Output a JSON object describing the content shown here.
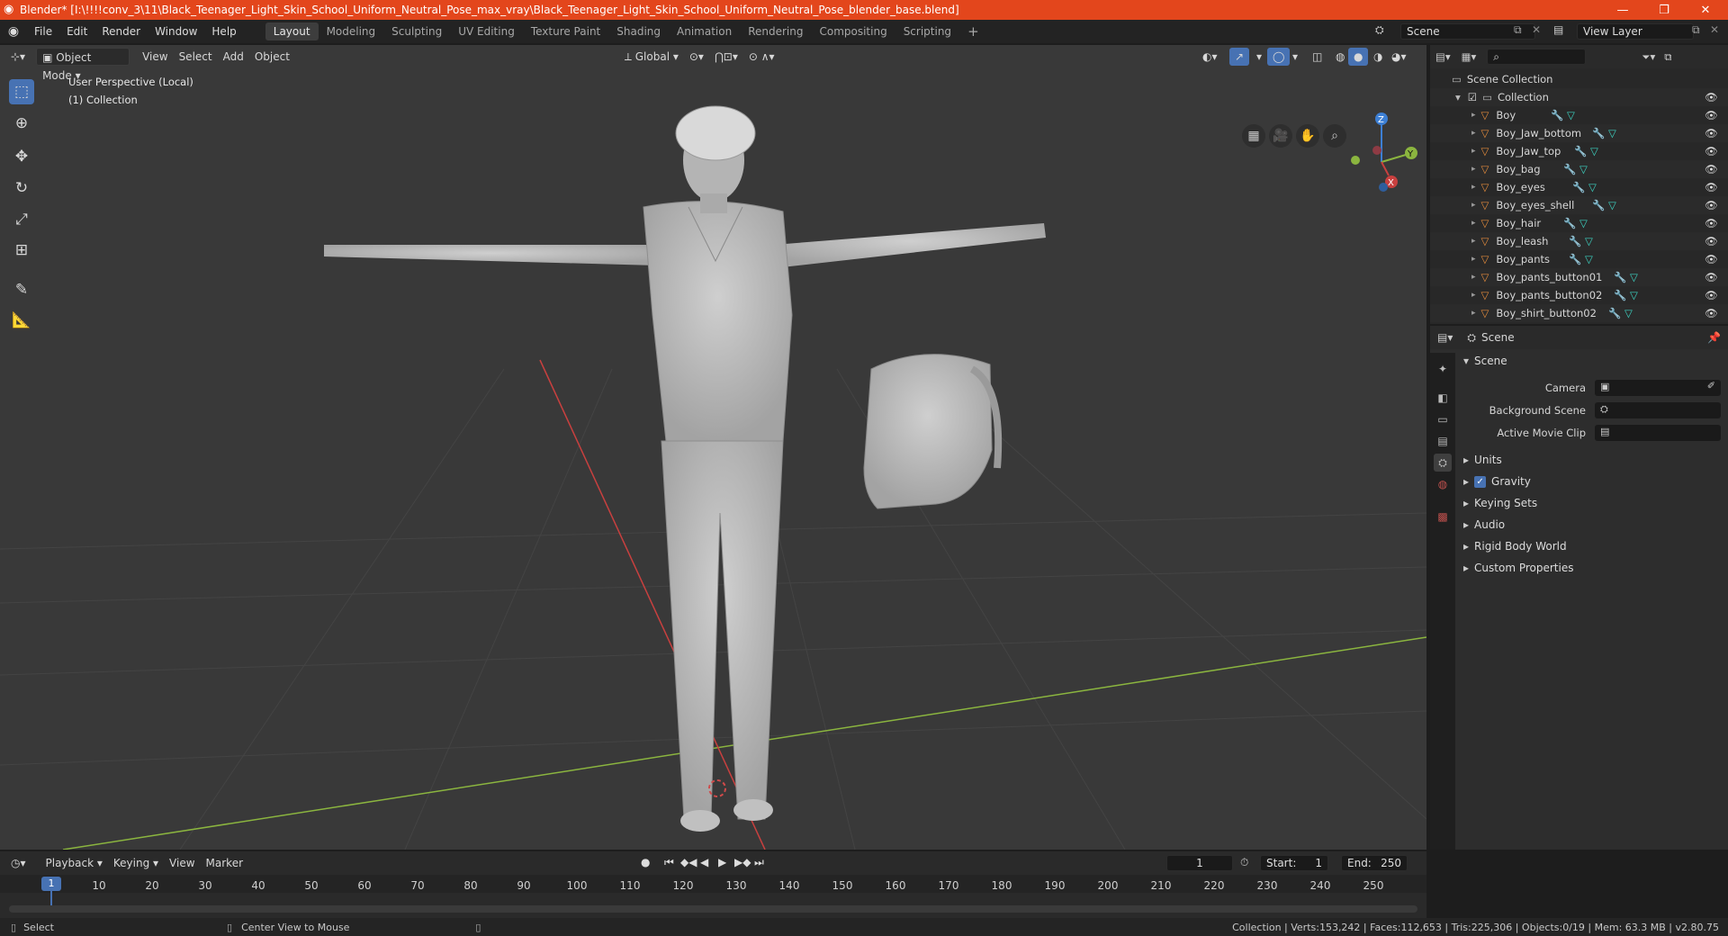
{
  "window": {
    "title": "Blender* [I:\\!!!!conv_3\\11\\Black_Teenager_Light_Skin_School_Uniform_Neutral_Pose_max_vray\\Black_Teenager_Light_Skin_School_Uniform_Neutral_Pose_blender_base.blend]",
    "minimize": "—",
    "maximize": "❐",
    "close": "✕"
  },
  "menu": [
    "File",
    "Edit",
    "Render",
    "Window",
    "Help"
  ],
  "workspaces": [
    "Layout",
    "Modeling",
    "Sculpting",
    "UV Editing",
    "Texture Paint",
    "Shading",
    "Animation",
    "Rendering",
    "Compositing",
    "Scripting"
  ],
  "active_workspace": "Layout",
  "add_workspace": "+",
  "scene_field": "Scene",
  "view_layer_field": "View Layer",
  "viewport": {
    "mode": "Object Mode",
    "menus": [
      "View",
      "Select",
      "Add",
      "Object"
    ],
    "transform_orientation": "Global",
    "overlay_text_line1": "User Perspective (Local)",
    "overlay_text_line2": "(1) Collection",
    "gizmo_axes": {
      "z": "Z",
      "y": "Y",
      "x": "X"
    }
  },
  "outliner": {
    "root": "Scene Collection",
    "collection": "Collection",
    "objects": [
      "Boy",
      "Boy_Jaw_bottom",
      "Boy_Jaw_top",
      "Boy_bag",
      "Boy_eyes",
      "Boy_eyes_shell",
      "Boy_hair",
      "Boy_leash",
      "Boy_pants",
      "Boy_pants_button01",
      "Boy_pants_button02",
      "Boy_shirt_button02"
    ]
  },
  "properties": {
    "header": "Scene",
    "panel": "Scene",
    "camera_label": "Camera",
    "background_scene_label": "Background Scene",
    "active_movie_clip_label": "Active Movie Clip",
    "sections": [
      "Units",
      "Gravity",
      "Keying Sets",
      "Audio",
      "Rigid Body World",
      "Custom Properties"
    ],
    "gravity_checked": true
  },
  "timeline": {
    "menus": [
      "Playback",
      "Keying",
      "View",
      "Marker"
    ],
    "current_frame": "1",
    "start_label": "Start:",
    "start_value": "1",
    "end_label": "End:",
    "end_value": "250",
    "ruler_current": "1",
    "ruler_ticks": [
      "10",
      "20",
      "30",
      "40",
      "50",
      "60",
      "70",
      "80",
      "90",
      "100",
      "110",
      "120",
      "130",
      "140",
      "150",
      "160",
      "170",
      "180",
      "190",
      "200",
      "210",
      "220",
      "230",
      "240",
      "250"
    ]
  },
  "statusbar": {
    "left_action": "Select",
    "middle_action": "Center View to Mouse",
    "stats": "Collection | Verts:153,242 | Faces:112,653 | Tris:225,306 | Objects:0/19 | Mem: 63.3 MB | v2.80.75"
  },
  "colors": {
    "title_bar": "#e3461c",
    "accent": "#4772b3",
    "x_axis": "#c8403f",
    "y_axis": "#8bb53f",
    "z_axis": "#3d7fd4"
  }
}
